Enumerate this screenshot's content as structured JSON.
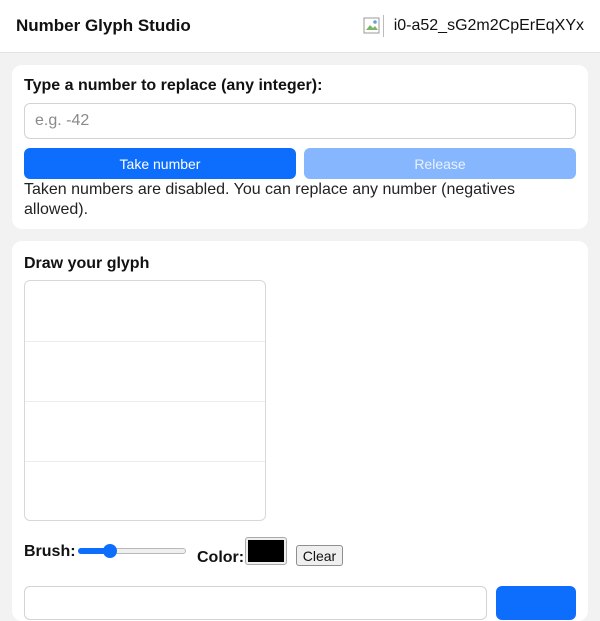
{
  "header": {
    "title": "Number Glyph Studio",
    "avatar_icon": "broken-image-icon",
    "user_id": "i0-a52_sG2m2CpErEqXYx"
  },
  "replace": {
    "label": "Type a number to replace (any integer):",
    "input_value": "",
    "placeholder": "e.g. -42",
    "take_label": "Take number",
    "release_label": "Release",
    "hint": "Taken numbers are disabled. You can replace any number (negatives allowed)."
  },
  "draw": {
    "title": "Draw your glyph",
    "brush_label": "Brush:",
    "brush_level": 0.3,
    "color_label": "Color:",
    "color_value": "#000000",
    "clear_label": "Clear"
  },
  "colors": {
    "accent": "#0d6efd",
    "accent_disabled": "#86b7fe",
    "page_bg": "#f2f2f2",
    "card_bg": "#ffffff"
  }
}
